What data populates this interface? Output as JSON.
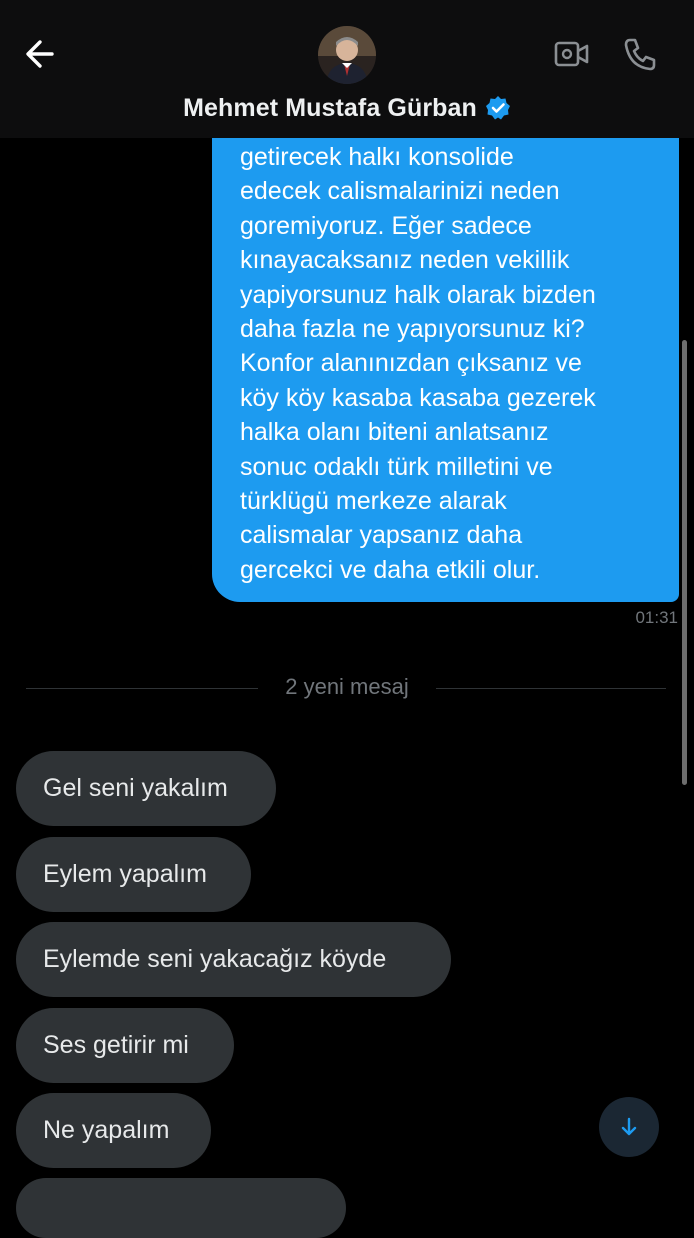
{
  "header": {
    "title": "Mehmet Mustafa Gürban",
    "back_icon": "arrow-left-icon",
    "verified_icon": "verified-badge-icon",
    "video_icon": "video-call-icon",
    "phone_icon": "phone-icon",
    "accent_color": "#1d9bf0"
  },
  "conversation": {
    "sent_message": {
      "text": "getirecek halkı konsolide\nedecek calismalarinizi neden\ngoremiyoruz. Eğer sadece\nkınayacaksanız neden vekillik\nyapiyorsunuz halk olarak bizden\ndaha fazla ne yapıyorsunuz ki?\nKonfor alanınızdan çıksanız ve\nköy köy kasaba kasaba gezerek\nhalka olanı biteni anlatsanız\nsonuc odaklı türk milletini ve\ntürklügü merkeze alarak\ncalismalar yapsanız daha\ngercekci ve daha etkili olur.",
      "time": "01:31"
    },
    "new_messages_divider": "2 yeni mesaj",
    "received_messages": [
      "Gel seni yakalım",
      "Eylem yapalım",
      "Eylemde seni yakacağız köyde",
      "Ses getirir mi",
      "Ne yapalım"
    ],
    "scroll_down_icon": "arrow-down-icon"
  }
}
